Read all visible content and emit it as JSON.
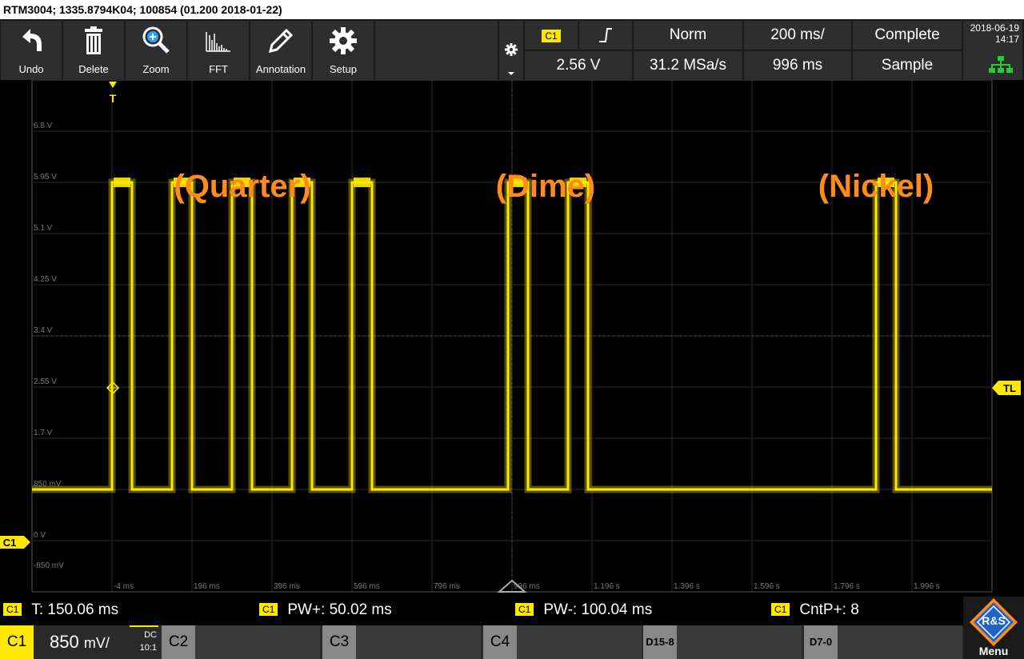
{
  "titlebar": "RTM3004; 1335.8794K04; 100854 (01.200 2018-01-22)",
  "toolbar": [
    {
      "label": "Undo",
      "icon": "undo-icon"
    },
    {
      "label": "Delete",
      "icon": "trash-icon"
    },
    {
      "label": "Zoom",
      "icon": "zoom-icon"
    },
    {
      "label": "FFT",
      "icon": "fft-icon"
    },
    {
      "label": "Annotation",
      "icon": "pencil-icon"
    },
    {
      "label": "Setup",
      "icon": "gear-icon"
    }
  ],
  "trigger": {
    "channel": "C1",
    "edge": "rising-edge-icon",
    "mode": "Norm",
    "timebase": "200 ms/",
    "acq_state": "Complete",
    "level": "2.56 V",
    "sample_rate": "31.2 MSa/s",
    "record_time": "996 ms",
    "acq_mode": "Sample"
  },
  "datetime": {
    "date": "2018-06-19",
    "time": "14:17"
  },
  "colors": {
    "trace": "#ffe800",
    "grid": "#3a3a3a",
    "annotation": "#ff8c1a"
  },
  "grid": {
    "y_labels": [
      "6.8 V",
      "5.95 V",
      "5.1 V",
      "4.25 V",
      "3.4 V",
      "2.55 V",
      "1.7 V",
      "850 mV",
      "0 V",
      "-850 mV"
    ],
    "x_labels": [
      "-4 ms",
      "196 ms",
      "396 ms",
      "596 ms",
      "796 ms",
      "996 ms",
      "1.196 s",
      "1.396 s",
      "1.596 s",
      "1.796 s",
      "1.996 s"
    ],
    "trigger_marker": "T",
    "level_marker": "TL",
    "channel_marker": "C1"
  },
  "annotations": [
    {
      "text": "(Quarter)"
    },
    {
      "text": "(Dime)"
    },
    {
      "text": "(Nickel)"
    }
  ],
  "trace": {
    "low_v": 0,
    "high_v": 5.1,
    "pulses_ms": [
      [
        0,
        50
      ],
      [
        150,
        200
      ],
      [
        300,
        350
      ],
      [
        450,
        500
      ],
      [
        600,
        650
      ],
      [
        990,
        1040
      ],
      [
        1140,
        1190
      ],
      [
        1910,
        1960
      ]
    ]
  },
  "measurements": [
    {
      "channel": "C1",
      "text": "T: 150.06 ms"
    },
    {
      "channel": "C1",
      "text": "PW+: 50.02 ms"
    },
    {
      "channel": "C1",
      "text": "PW-: 100.04 ms"
    },
    {
      "channel": "C1",
      "text": "CntP+: 8"
    }
  ],
  "channels": {
    "c1": {
      "name": "C1",
      "scale_value": "850",
      "scale_unit": "mV/",
      "coupling": "DC",
      "probe": "10:1"
    },
    "others": [
      "C2",
      "C3",
      "C4",
      "D15-8",
      "D7-0"
    ]
  },
  "menu": {
    "label": "Menu",
    "logo": "R&S"
  }
}
